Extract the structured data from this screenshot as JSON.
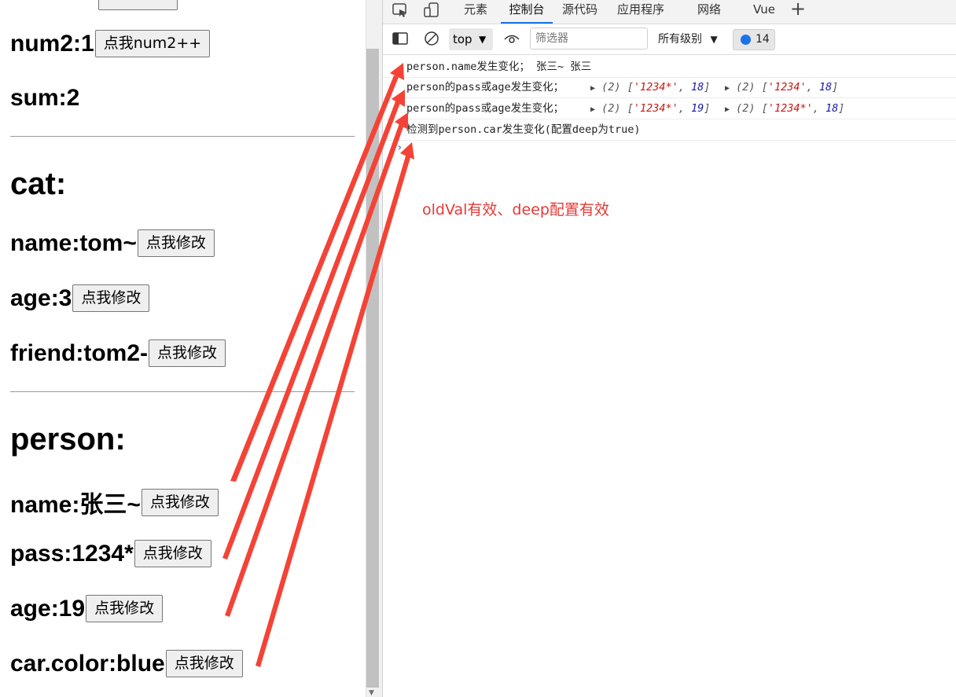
{
  "left": {
    "rows": [
      {
        "label": "num2:1",
        "button": "点我num2++"
      },
      {
        "label": "sum:2"
      },
      {
        "label": "cat:"
      },
      {
        "label": "name:tom~",
        "button": "点我修改"
      },
      {
        "label": "age:3",
        "button": "点我修改"
      },
      {
        "label": "friend:tom2-",
        "button": "点我修改"
      },
      {
        "label": "person:"
      },
      {
        "label": "name:张三~",
        "button": "点我修改"
      },
      {
        "label": "pass:1234*",
        "button": "点我修改"
      },
      {
        "label": "age:19",
        "button": "点我修改"
      },
      {
        "label": "car.color:blue",
        "button": "点我修改"
      }
    ]
  },
  "devtools": {
    "tabs": [
      "元素",
      "控制台",
      "源代码",
      "应用程序",
      "网络",
      "Vue"
    ],
    "active_tab": "控制台",
    "toolbar": {
      "context": "top",
      "filter_placeholder": "筛选器",
      "levels": "所有级别",
      "message_count": "14"
    },
    "console": [
      {
        "text": "person.name发生变化； 张三~ 张三"
      },
      {
        "text": "person的pass或age发生变化；",
        "a1": {
          "len": "(2)",
          "v1": "'1234*'",
          "v2": "18"
        },
        "a2": {
          "len": "(2)",
          "v1": "'1234'",
          "v2": "18"
        }
      },
      {
        "text": "person的pass或age发生变化；",
        "a1": {
          "len": "(2)",
          "v1": "'1234*'",
          "v2": "19"
        },
        "a2": {
          "len": "(2)",
          "v1": "'1234*'",
          "v2": "18"
        }
      },
      {
        "text": "检测到person.car发生变化(配置deep为true)"
      }
    ]
  },
  "annotation": "oldVal有效、deep配置有效",
  "colors": {
    "annotation": "#e53935",
    "active_tab": "#1a73e8"
  },
  "icons": [
    "inspect-icon",
    "device-toolbar-icon",
    "add-tab-icon",
    "sidebar-toggle-icon",
    "clear-console-icon",
    "dropdown-caret-icon",
    "eye-icon",
    "message-icon"
  ]
}
